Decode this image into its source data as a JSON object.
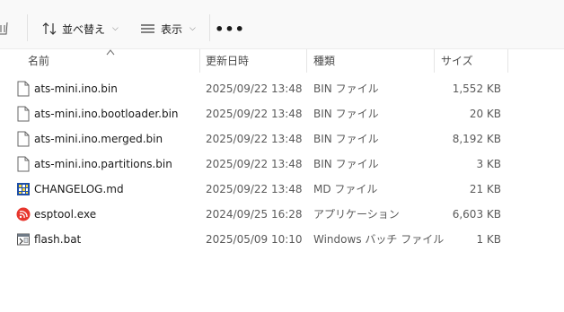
{
  "toolbar": {
    "sort_label": "並べ替え",
    "view_label": "表示",
    "more_label": "•••"
  },
  "columns": {
    "name": "名前",
    "date": "更新日時",
    "type": "種類",
    "size": "サイズ"
  },
  "files": [
    {
      "name": "ats-mini.ino.bin",
      "date": "2025/09/22 13:48",
      "type": "BIN ファイル",
      "size": "1,552 KB",
      "icon": "file-icon"
    },
    {
      "name": "ats-mini.ino.bootloader.bin",
      "date": "2025/09/22 13:48",
      "type": "BIN ファイル",
      "size": "20 KB",
      "icon": "file-icon"
    },
    {
      "name": "ats-mini.ino.merged.bin",
      "date": "2025/09/22 13:48",
      "type": "BIN ファイル",
      "size": "8,192 KB",
      "icon": "file-icon"
    },
    {
      "name": "ats-mini.ino.partitions.bin",
      "date": "2025/09/22 13:48",
      "type": "BIN ファイル",
      "size": "3 KB",
      "icon": "file-icon"
    },
    {
      "name": "CHANGELOG.md",
      "date": "2025/09/22 13:48",
      "type": "MD ファイル",
      "size": "21 KB",
      "icon": "markdown-file-icon"
    },
    {
      "name": "esptool.exe",
      "date": "2024/09/25 16:28",
      "type": "アプリケーション",
      "size": "6,603 KB",
      "icon": "esptool-app-icon"
    },
    {
      "name": "flash.bat",
      "date": "2025/05/09 10:10",
      "type": "Windows バッチ ファイル",
      "size": "1 KB",
      "icon": "batch-file-icon"
    }
  ]
}
